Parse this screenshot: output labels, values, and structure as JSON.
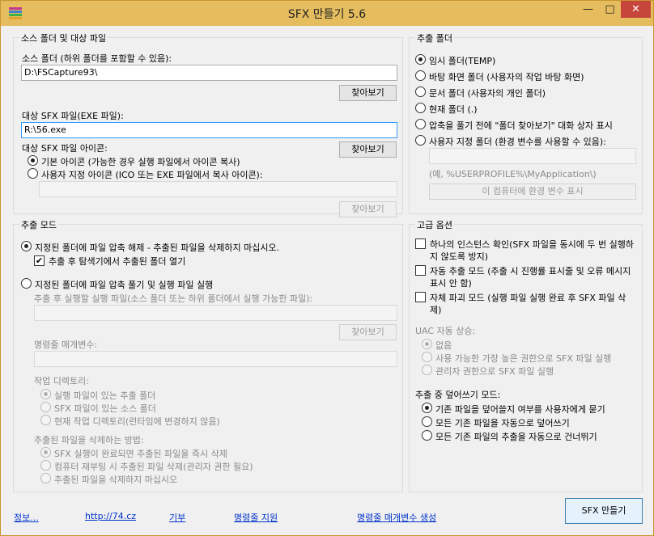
{
  "window": {
    "title": "SFX 만들기 5.6",
    "minimize_glyph": "—",
    "maximize_glyph": "□",
    "close_glyph": "✕"
  },
  "source_group": {
    "legend": "소스 폴더 및 대상 파일",
    "source_label": "소스 폴더 (하위 폴더를 포함할 수 있음):",
    "source_value": "D:\\FSCapture93\\",
    "browse1": "찾아보기",
    "target_label": "대상 SFX 파일(EXE 파일):",
    "target_value": "R:\\56.exe",
    "browse2": "찾아보기",
    "icon_label": "대상 SFX 파일 아이콘:",
    "icon_opt1": "기본 아이콘 (가능한 경우 실행 파일에서 아이콘 복사)",
    "icon_opt2": "사용자 지정 아이콘 (ICO 또는 EXE 파일에서 복사 아이콘):",
    "browse3": "찾아보기"
  },
  "extract_folder": {
    "legend": "추출 폴더",
    "opt1": "임시 폴더(TEMP)",
    "opt2": "바탕 화면 폴더 (사용자의 작업 바탕 화면)",
    "opt3": "문서 폴더 (사용자의 개인 폴더)",
    "opt4": "현재 폴더 (.)",
    "opt5": "압축을 풀기 전에 \"폴더 찾아보기\" 대화 상자 표시",
    "opt6": "사용자 지정 폴더 (환경 변수를 사용할 수 있음):",
    "example": "(예, %USERPROFILE%\\MyApplication\\)",
    "env_button": "이 컴퓨터에 환경 변수 표시"
  },
  "extract_mode": {
    "legend": "추출 모드",
    "opt1": "지정된 폴더에 파일 압축 해제 - 추출된 파일을 삭제하지 마십시오.",
    "check1": "추출 후 탐색기에서 추출된 폴더 열기",
    "opt2": "지정된 폴더에 파일 압축 풀기 및 실행 파일 실행",
    "exe_label": "추출 후 실행할 실행 파일(소스 폴더 또는 하위 폴더에서 실행 가능한 파일):",
    "browse": "찾아보기",
    "cmd_label": "명령줄 매개변수:",
    "workdir_label": "작업 디렉토리:",
    "wd1": "실행 파일이 있는 추출 폴더",
    "wd2": "SFX 파일이 있는 소스 폴더",
    "wd3": "현재 작업 디렉토리(런타임에 변경하지 않음)",
    "delete_label": "추출된 파일을 삭제하는 방법:",
    "del1": "SFX 실행이 완료되면 추출된 파일을 즉시 삭제",
    "del2": "컴퓨터 재부팅 시 추출된 파일 삭제(관리자 권한 필요)",
    "del3": "추출된 파일을 삭제하지 마십시오"
  },
  "advanced": {
    "legend": "고급 옵션",
    "c1": "하나의 인스턴스 확인(SFX 파일을 동시에 두 번 실행하지 않도록 방지)",
    "c2": "자동 추출 모드 (추출 시 진행률 표시줄 및 오류 메시지 표시 안 함)",
    "c3": "자체 파괴 모드 (실행 파일 실행 완료 후 SFX 파일 삭제)",
    "uac_label": "UAC 자동 상승:",
    "u1": "없음",
    "u2": "사용 가능한 가장 높은 권한으로 SFX 파일 실행",
    "u3": "관리자 권한으로 SFX 파일 실행",
    "overwrite_label": "추출 중 덮어쓰기 모드:",
    "o1": "기존 파일을 덮어쓸지 여부를 사용자에게 묻기",
    "o2": "모든 기존 파일을 자동으로 덮어쓰기",
    "o3": "모든 기존 파일의 추출을 자동으로 건너뛰기"
  },
  "footer": {
    "info": "정보...",
    "url": "http://74.cz",
    "donate": "기부",
    "cmd_support": "명령줄 지원",
    "cmd_gen": "명령줄 매개변수 생성",
    "create": "SFX 만들기"
  },
  "checkmark": "✔"
}
